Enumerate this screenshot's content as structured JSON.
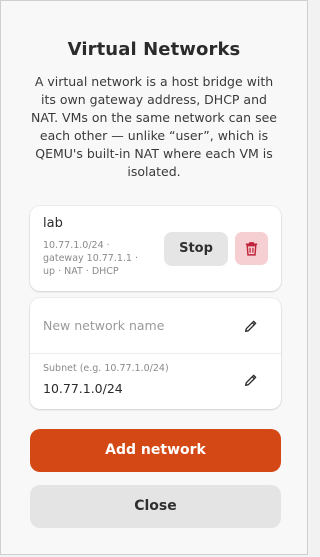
{
  "dialog": {
    "title": "Virtual Networks",
    "description": "A virtual network is a host bridge with its own gateway address, DHCP and NAT. VMs on the same network can see each other — unlike “user”, which is QEMU's built-in NAT where each VM is isolated."
  },
  "networks": [
    {
      "name": "lab",
      "detail": "10.77.1.0/24 · gateway 10.77.1.1 · up · NAT · DHCP",
      "stop_label": "Stop",
      "delete_icon": "trash-icon"
    }
  ],
  "form": {
    "name_placeholder": "New network name",
    "name_value": "",
    "subnet_label": "Subnet (e.g. 10.77.1.0/24)",
    "subnet_value": "10.77.1.0/24",
    "edit_icon": "pencil-icon"
  },
  "actions": {
    "add_label": "Add network",
    "close_label": "Close"
  },
  "colors": {
    "accent": "#d44815",
    "danger_bg": "#f6cfd3",
    "danger_icon": "#c0243a"
  }
}
